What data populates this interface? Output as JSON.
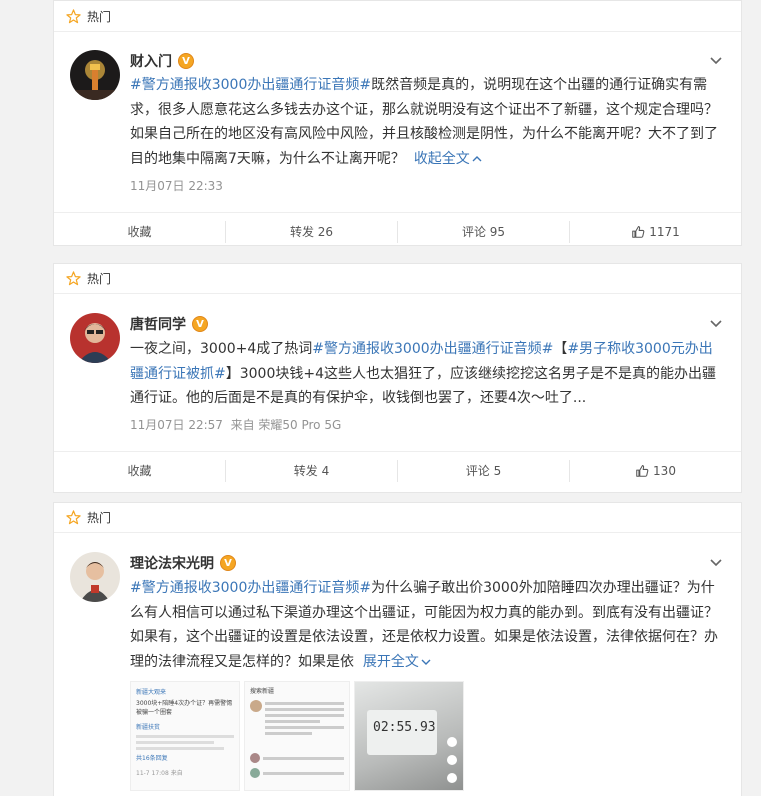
{
  "posts": [
    {
      "hot_label": "热门",
      "author": "财入门",
      "tag": "#警方通报收3000办出疆通行证音频#",
      "body": "既然音频是真的，说明现在这个出疆的通行证确实有需求，很多人愿意花这么多钱去办这个证，那么就说明没有这个证出不了新疆，这个规定合理吗？如果自己所在的地区没有高风险中风险，并且核酸检测是阴性，为什么不能离开呢？大不了到了目的地集中隔离7天嘛，为什么不让离开呢？",
      "expand": "收起全文",
      "time": "11月07日 22:33",
      "source": "",
      "actions": {
        "collect": "收藏",
        "repost": "转发 26",
        "comment": "评论 95",
        "like": "1171"
      }
    },
    {
      "hot_label": "热门",
      "author": "唐哲同学",
      "body_prefix": "一夜之间，3000+4成了热词",
      "tag": "#警方通报收3000办出疆通行证音频#",
      "mid_text": "【",
      "tag2": "#男子称收3000元办出疆通行证被抓#",
      "body": "】3000块钱+4这些人也太猖狂了，应该继续挖挖这名男子是不是真的能办出疆通行证。他的后面是不是真的有保护伞，收钱倒也罢了，还要4次～吐了...",
      "time": "11月07日 22:57",
      "source": "来自 荣耀50 Pro 5G",
      "actions": {
        "collect": "收藏",
        "repost": "转发 4",
        "comment": "评论 5",
        "like": "130"
      }
    },
    {
      "hot_label": "热门",
      "author": "理论法宋光明",
      "tag": "#警方通报收3000办出疆通行证音频#",
      "body": "为什么骗子敢出价3000外加陪睡四次办理出疆证？为什么有人相信可以通过私下渠道办理这个出疆证，可能因为权力真的能办到。到底有没有出疆证？如果有，这个出疆证的设置是依法设置，还是依权力设置。如果是依法设置，法律依据何在？办理的法律流程又是怎样的？如果是依",
      "expand": "展开全文",
      "thumb1_title": "新疆大观来",
      "thumb1_text": "3000块+陪睡4次办个证？再需警惕被骗一个圈套",
      "thumb1_user": "新疆扶贫",
      "thumb1_more": "共16条回复",
      "thumb1_date": "11-7 17:08 来自",
      "thumb2_title": "搜索新疆",
      "thumb3_timer": "02:55.93"
    }
  ]
}
